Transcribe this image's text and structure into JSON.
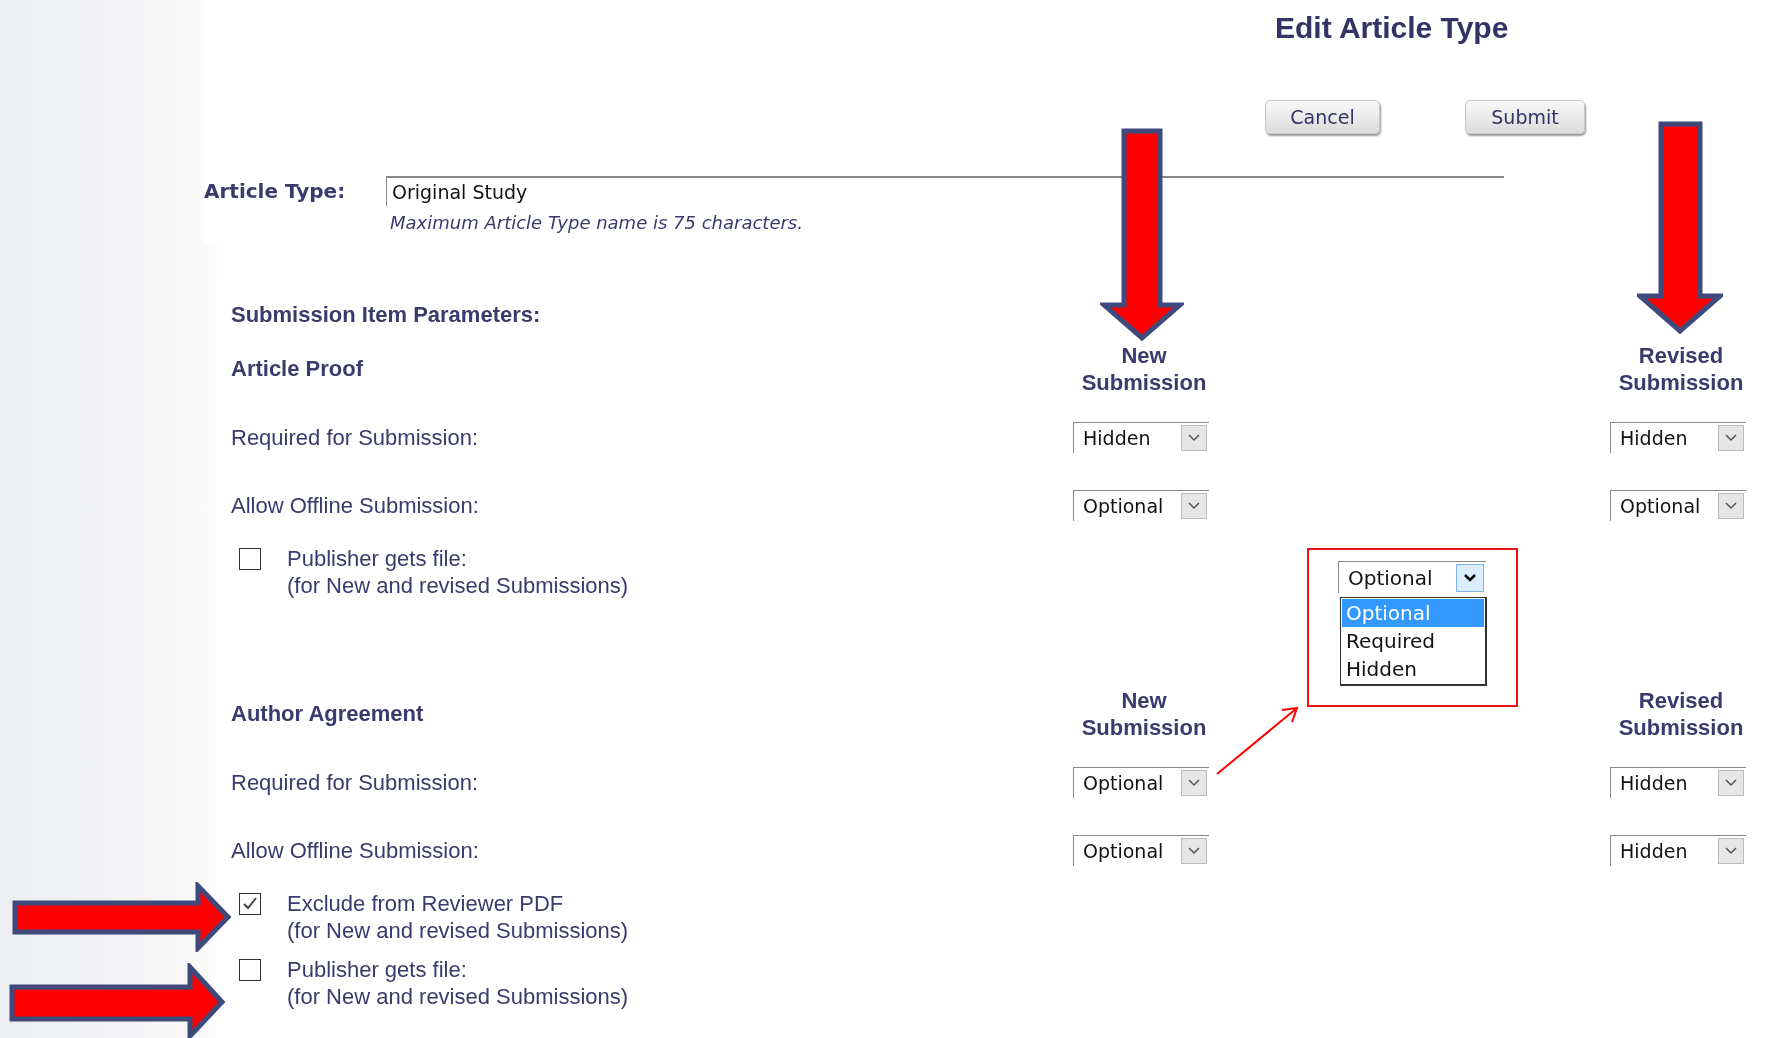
{
  "title": "Edit Article Type",
  "buttons": [
    {
      "label": "Cancel"
    },
    {
      "label": "Submit"
    }
  ],
  "article_type": {
    "label": "Article Type:",
    "value": "Original Study",
    "hint": "Maximum Article Type name is 75 characters."
  },
  "parameters_heading": "Submission Item Parameters:",
  "sections": [
    {
      "title": "Article Proof",
      "columns": [
        "New Submission",
        "Revised Submission"
      ],
      "rows": [
        {
          "kind": "select",
          "label": "Required for Submission:",
          "values": [
            "Hidden",
            "Hidden"
          ]
        },
        {
          "kind": "select",
          "label": "Allow Offline Submission:",
          "values": [
            "Optional",
            "Optional"
          ]
        },
        {
          "kind": "checkbox",
          "label": "Publisher gets file:",
          "note": "(for New and revised Submissions)",
          "checked": false
        }
      ]
    },
    {
      "title": "Author Agreement",
      "columns": [
        "New Submission",
        "Revised Submission"
      ],
      "rows": [
        {
          "kind": "select",
          "label": "Required for Submission:",
          "values": [
            "Optional",
            "Hidden"
          ]
        },
        {
          "kind": "select",
          "label": "Allow Offline Submission:",
          "values": [
            "Optional",
            "Hidden"
          ]
        },
        {
          "kind": "checkbox",
          "label": "Exclude from Reviewer PDF",
          "note": "(for New and revised Submissions)",
          "checked": true
        },
        {
          "kind": "checkbox",
          "label": "Publisher gets file:",
          "note": "(for New and revised Submissions)",
          "checked": false
        }
      ]
    }
  ],
  "dropdown_callout": {
    "value": "Optional",
    "options": [
      {
        "label": "Optional",
        "selected": true
      },
      {
        "label": "Required",
        "selected": false
      },
      {
        "label": "Hidden",
        "selected": false
      }
    ]
  }
}
